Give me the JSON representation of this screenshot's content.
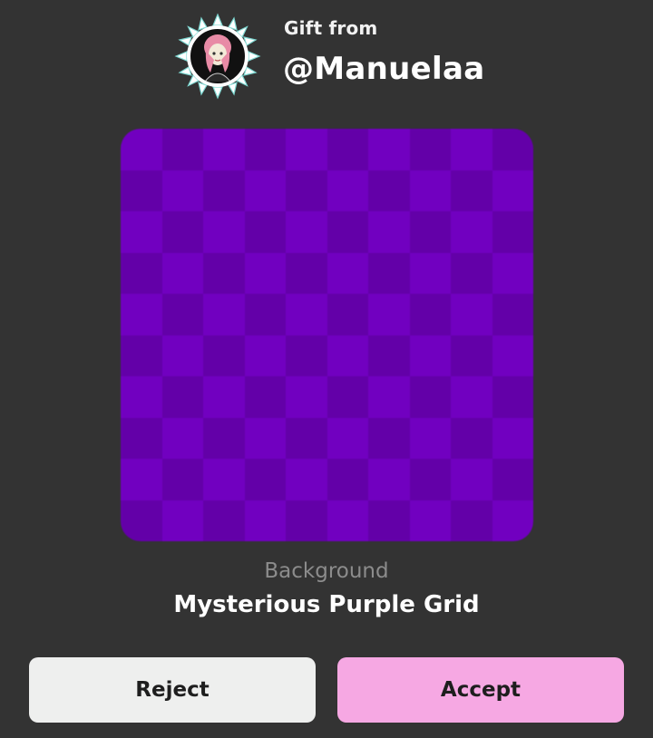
{
  "gift": {
    "label": "Gift from",
    "username": "@Manuelaa"
  },
  "avatar": {
    "icon": "sun-frame-avatar-icon"
  },
  "item": {
    "type": "Background",
    "name": "Mysterious Purple Grid",
    "preview": {
      "pattern": "checkerboard",
      "grid": 10,
      "color_a": "#7100c0",
      "color_b": "#6300a8"
    }
  },
  "actions": {
    "reject_label": "Reject",
    "accept_label": "Accept",
    "reject_color": "#eeefee",
    "accept_color": "#f6a8e3"
  }
}
